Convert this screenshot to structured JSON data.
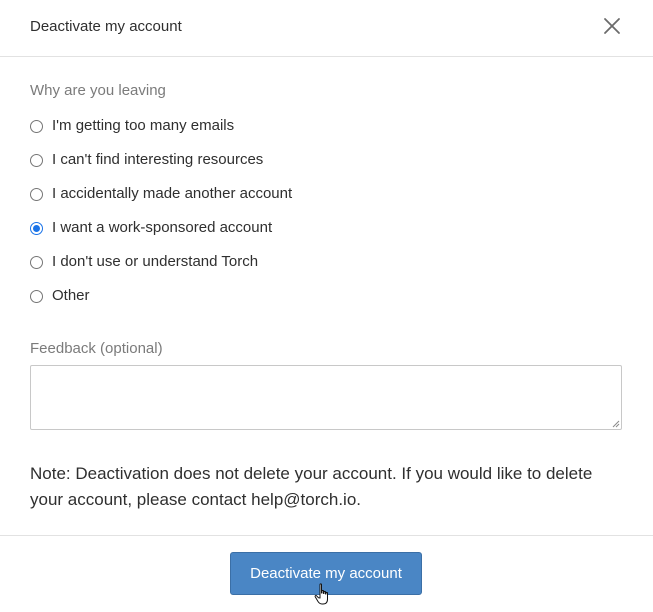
{
  "dialog": {
    "title": "Deactivate my account",
    "close_icon": "close-icon"
  },
  "reasons": {
    "label": "Why are you leaving",
    "options": [
      {
        "label": "I'm getting too many emails",
        "selected": false
      },
      {
        "label": "I can't find interesting resources",
        "selected": false
      },
      {
        "label": "I accidentally made another account",
        "selected": false
      },
      {
        "label": "I want a work-sponsored account",
        "selected": true
      },
      {
        "label": "I don't use or understand Torch",
        "selected": false
      },
      {
        "label": "Other",
        "selected": false
      }
    ]
  },
  "feedback": {
    "label": "Feedback (optional)",
    "value": ""
  },
  "note": {
    "text": "Note: Deactivation does not delete your account. If you would like to delete your account, please contact help@torch.io."
  },
  "footer": {
    "deactivate_label": "Deactivate my account"
  },
  "colors": {
    "accent": "#4a86c5",
    "radio_selected": "#1a73e8",
    "divider": "#e2e2e2"
  }
}
